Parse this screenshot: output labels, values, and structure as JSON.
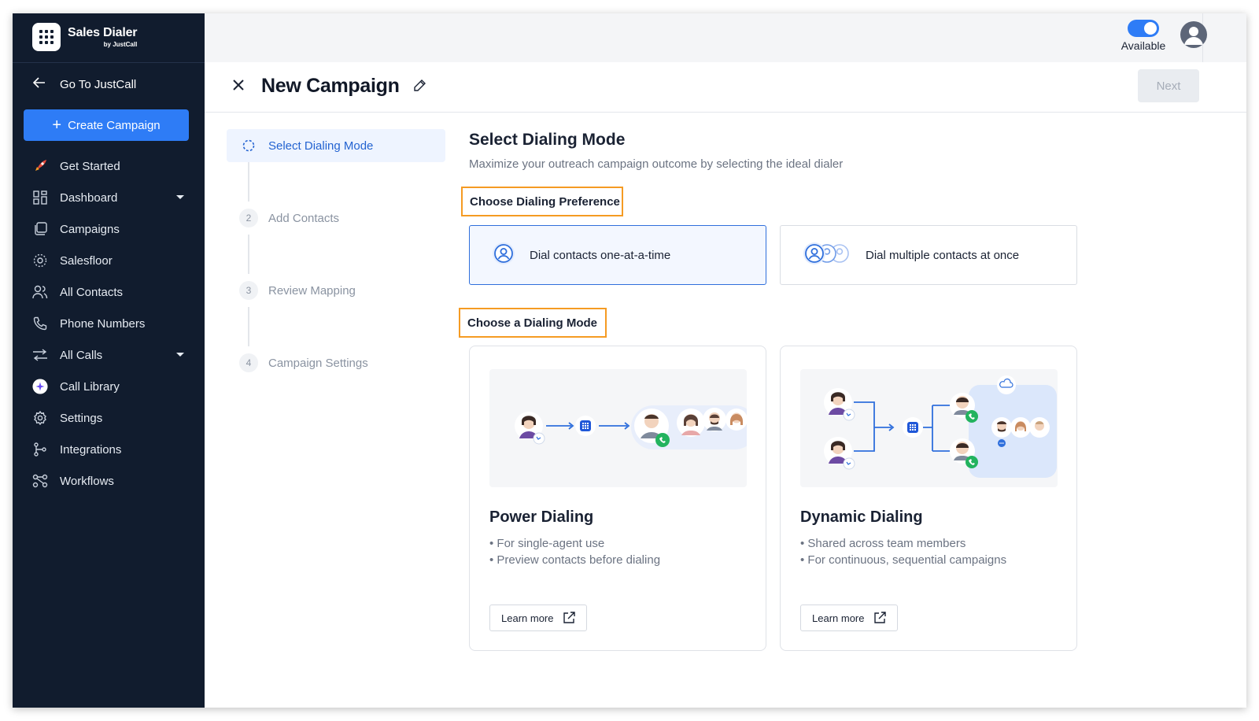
{
  "brand": {
    "name": "Sales Dialer",
    "sub": "by JustCall"
  },
  "sidebar": {
    "goto_label": "Go To JustCall",
    "create_label": "Create Campaign",
    "items": [
      {
        "label": "Get Started",
        "icon": "rocket-icon"
      },
      {
        "label": "Dashboard",
        "icon": "dashboard-icon",
        "has_caret": true
      },
      {
        "label": "Campaigns",
        "icon": "campaigns-icon"
      },
      {
        "label": "Salesfloor",
        "icon": "salesfloor-icon"
      },
      {
        "label": "All Contacts",
        "icon": "contacts-icon"
      },
      {
        "label": "Phone Numbers",
        "icon": "phone-icon"
      },
      {
        "label": "All Calls",
        "icon": "calls-icon",
        "has_caret": true
      },
      {
        "label": "Call Library",
        "icon": "call-library-icon"
      },
      {
        "label": "Settings",
        "icon": "settings-icon"
      },
      {
        "label": "Integrations",
        "icon": "integrations-icon"
      },
      {
        "label": "Workflows",
        "icon": "workflows-icon"
      }
    ]
  },
  "topbar": {
    "status_label": "Available"
  },
  "header": {
    "title": "New Campaign",
    "next_label": "Next"
  },
  "steps": [
    {
      "number": "",
      "label": "Select Dialing Mode",
      "active": true
    },
    {
      "number": "2",
      "label": "Add Contacts"
    },
    {
      "number": "3",
      "label": "Review Mapping"
    },
    {
      "number": "4",
      "label": "Campaign Settings"
    }
  ],
  "content": {
    "title": "Select Dialing Mode",
    "subtitle": "Maximize your outreach campaign outcome by selecting the ideal dialer",
    "preference_heading": "Choose Dialing Preference",
    "preferences": [
      {
        "label": "Dial contacts one-at-a-time",
        "selected": true
      },
      {
        "label": "Dial multiple contacts at once",
        "selected": false
      }
    ],
    "mode_heading": "Choose a Dialing Mode",
    "modes": [
      {
        "title": "Power Dialing",
        "bullets": [
          "• For single-agent use",
          "• Preview contacts before dialing"
        ],
        "learn_more": "Learn more"
      },
      {
        "title": "Dynamic Dialing",
        "bullets": [
          "• Shared across team members",
          "• For continuous, sequential campaigns"
        ],
        "learn_more": "Learn more"
      }
    ]
  },
  "colors": {
    "sidebar_bg": "#111c2e",
    "accent": "#2e7cf6",
    "highlight_border": "#f59b23",
    "call_green": "#22b35e"
  }
}
